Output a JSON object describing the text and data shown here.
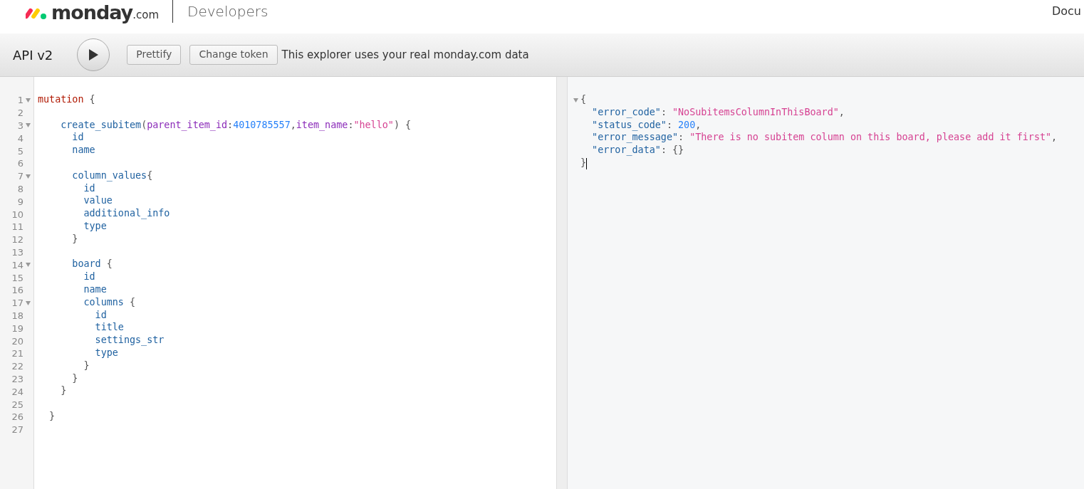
{
  "header": {
    "logo_word": "monday",
    "logo_suffix": ".com",
    "section": "Developers",
    "nav_link": "Docu"
  },
  "toolbar": {
    "title": "API v2",
    "buttons": [
      "Prettify",
      "Change token"
    ],
    "notice": "This explorer uses your real monday.com data"
  },
  "query_editor": {
    "lines": [
      {
        "number": "1",
        "foldable": true,
        "tokens": [
          {
            "kind": "keyword",
            "text": "mutation"
          },
          {
            "kind": "punct",
            "text": " {"
          }
        ]
      },
      {
        "number": "2",
        "foldable": false
      },
      {
        "number": "3",
        "foldable": true,
        "tokens": [
          {
            "kind": "field",
            "text": "    create_subitem"
          },
          {
            "kind": "punct",
            "text": "("
          },
          {
            "kind": "arg",
            "text": "parent_item_id"
          },
          {
            "kind": "punct",
            "text": ":"
          },
          {
            "kind": "number",
            "text": "4010785557"
          },
          {
            "kind": "punct",
            "text": ","
          },
          {
            "kind": "arg",
            "text": "item_name"
          },
          {
            "kind": "punct",
            "text": ":"
          },
          {
            "kind": "string",
            "text": "\"hello\""
          },
          {
            "kind": "punct",
            "text": ") {"
          }
        ]
      },
      {
        "number": "4",
        "foldable": false,
        "tokens": [
          {
            "kind": "field",
            "text": "      id"
          }
        ]
      },
      {
        "number": "5",
        "foldable": false,
        "tokens": [
          {
            "kind": "field",
            "text": "      name"
          }
        ]
      },
      {
        "number": "6",
        "foldable": false
      },
      {
        "number": "7",
        "foldable": true,
        "tokens": [
          {
            "kind": "field",
            "text": "      column_values"
          },
          {
            "kind": "punct",
            "text": "{"
          }
        ]
      },
      {
        "number": "8",
        "foldable": false,
        "tokens": [
          {
            "kind": "field",
            "text": "        id"
          }
        ]
      },
      {
        "number": "9",
        "foldable": false,
        "tokens": [
          {
            "kind": "field",
            "text": "        value"
          }
        ]
      },
      {
        "number": "10",
        "foldable": false,
        "tokens": [
          {
            "kind": "field",
            "text": "        additional_info"
          }
        ]
      },
      {
        "number": "11",
        "foldable": false,
        "tokens": [
          {
            "kind": "field",
            "text": "        type"
          }
        ]
      },
      {
        "number": "12",
        "foldable": false,
        "tokens": [
          {
            "kind": "punct",
            "text": "      }"
          }
        ]
      },
      {
        "number": "13",
        "foldable": false
      },
      {
        "number": "14",
        "foldable": true,
        "tokens": [
          {
            "kind": "field",
            "text": "      board"
          },
          {
            "kind": "punct",
            "text": " {"
          }
        ]
      },
      {
        "number": "15",
        "foldable": false,
        "tokens": [
          {
            "kind": "field",
            "text": "        id"
          }
        ]
      },
      {
        "number": "16",
        "foldable": false,
        "tokens": [
          {
            "kind": "field",
            "text": "        name"
          }
        ]
      },
      {
        "number": "17",
        "foldable": true,
        "tokens": [
          {
            "kind": "field",
            "text": "        columns"
          },
          {
            "kind": "punct",
            "text": " {"
          }
        ]
      },
      {
        "number": "18",
        "foldable": false,
        "tokens": [
          {
            "kind": "field",
            "text": "          id"
          }
        ]
      },
      {
        "number": "19",
        "foldable": false,
        "tokens": [
          {
            "kind": "field",
            "text": "          title"
          }
        ]
      },
      {
        "number": "20",
        "foldable": false,
        "tokens": [
          {
            "kind": "field",
            "text": "          settings_str"
          }
        ]
      },
      {
        "number": "21",
        "foldable": false,
        "tokens": [
          {
            "kind": "field",
            "text": "          type"
          }
        ]
      },
      {
        "number": "22",
        "foldable": false,
        "tokens": [
          {
            "kind": "punct",
            "text": "        }"
          }
        ]
      },
      {
        "number": "23",
        "foldable": false,
        "tokens": [
          {
            "kind": "punct",
            "text": "      }"
          }
        ]
      },
      {
        "number": "24",
        "foldable": false,
        "tokens": [
          {
            "kind": "punct",
            "text": "    }"
          }
        ]
      },
      {
        "number": "25",
        "foldable": false
      },
      {
        "number": "26",
        "foldable": false,
        "tokens": [
          {
            "kind": "punct",
            "text": "  }"
          }
        ]
      },
      {
        "number": "27",
        "foldable": false
      }
    ]
  },
  "result_viewer": {
    "lines": [
      {
        "foldable": true,
        "cursor": false,
        "tokens": [
          {
            "kind": "punct",
            "text": "{"
          }
        ]
      },
      {
        "foldable": false,
        "cursor": false,
        "tokens": [
          {
            "kind": "key",
            "text": "  \"error_code\""
          },
          {
            "kind": "punct",
            "text": ": "
          },
          {
            "kind": "string",
            "text": "\"NoSubitemsColumnInThisBoard\""
          },
          {
            "kind": "punct",
            "text": ","
          }
        ]
      },
      {
        "foldable": false,
        "cursor": false,
        "tokens": [
          {
            "kind": "key",
            "text": "  \"status_code\""
          },
          {
            "kind": "punct",
            "text": ": "
          },
          {
            "kind": "number",
            "text": "200"
          },
          {
            "kind": "punct",
            "text": ","
          }
        ]
      },
      {
        "foldable": false,
        "cursor": false,
        "tokens": [
          {
            "kind": "key",
            "text": "  \"error_message\""
          },
          {
            "kind": "punct",
            "text": ": "
          },
          {
            "kind": "string",
            "text": "\"There is no subitem column on this board, please add it first\""
          },
          {
            "kind": "punct",
            "text": ","
          }
        ]
      },
      {
        "foldable": false,
        "cursor": false,
        "tokens": [
          {
            "kind": "key",
            "text": "  \"error_data\""
          },
          {
            "kind": "punct",
            "text": ": {}"
          }
        ]
      },
      {
        "foldable": false,
        "cursor": true,
        "tokens": [
          {
            "kind": "punct",
            "text": "}"
          }
        ]
      }
    ]
  }
}
